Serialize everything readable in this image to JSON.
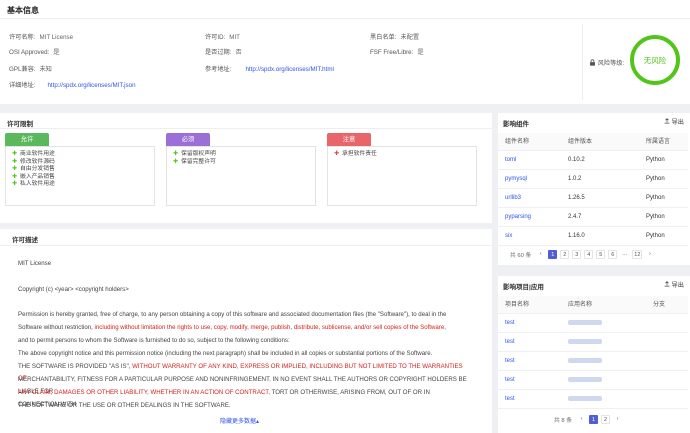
{
  "basic": {
    "title": "基本信息",
    "license_name_label": "许可名称:",
    "license_name": "MIT License",
    "license_id_label": "许可ID:",
    "license_id": "MIT",
    "blacklist_label": "黑白名单:",
    "blacklist": "未配置",
    "osi_label": "OSI Approved:",
    "osi": "是",
    "deprecated_label": "是否过期:",
    "deprecated": "否",
    "fsf_label": "FSF Free/Libre:",
    "fsf": "是",
    "gpl_label": "GPL兼容:",
    "gpl": "未知",
    "ref_label": "参考地址:",
    "ref_url": "http://spdx.org/licenses/MIT.html",
    "detail_label": "详细地址:",
    "detail_url": "http://spdx.org/licenses/MIT.json",
    "risk_label": "风险等级:",
    "risk_value": "无风险",
    "risk_color": "#52c41a"
  },
  "restrictions": {
    "title": "许可限制",
    "allowed": {
      "label": "允许",
      "color": "#5cb85c",
      "items": [
        "商业软件用途",
        "修改软件源码",
        "自由分发销售",
        "嵌入产品销售",
        "私人软件用途"
      ]
    },
    "required": {
      "label": "必须",
      "color": "#9b6fd6",
      "items": [
        "保留版权声明",
        "保留完整许可"
      ]
    },
    "note": {
      "label": "注意",
      "color": "#e8666a",
      "items": [
        "承担软件责任"
      ]
    }
  },
  "description": {
    "title": "许可描述",
    "p1": "MIT License",
    "p2": "Copyright (c) <year> <copyright holders>",
    "p3a": "Permission is hereby granted, free of charge, to any person obtaining a copy of this software and associated documentation files (the \"Software\"), to deal in the",
    "p3b_plain": "Software without restriction, ",
    "p3b_red": "including without limitation the rights to use, copy, modify, merge, publish, distribute, sublicense, and/or sell copies of the Software,",
    "p3c": "and to permit persons to whom the Software is furnished to do so, subject to the following conditions:",
    "p4": "The above copyright notice and this permission notice (including the next paragraph) shall be included in all copies or substantial portions of the Software.",
    "p5a_plain": "THE SOFTWARE IS PROVIDED \"AS IS\", ",
    "p5a_red": "WITHOUT WARRANTY OF ANY KIND, EXPRESS OR IMPLIED, INCLUDING BUT NOT LIMITED TO THE WARRANTIES OF",
    "p5b_red": "MERCHANTABILITY, FITNESS FOR A PARTICULAR PURPOSE AND NONINFRINGEMENT. IN NO EVENT SHALL THE AUTHORS OR COPYRIGHT HOLDERS BE LIABLE FOR",
    "p5c_red": "ANY CLAIM, DAMAGES OR OTHER LIABILITY, WHETHER IN AN ACTION OF CONTRACT,",
    "p5c_plain": " TORT OR OTHERWISE, ARISING FROM, OUT OF OR IN CONNECTION WITH",
    "p5d": "THE SOFTWARE OR THE USE OR OTHER DEALINGS IN THE SOFTWARE.",
    "collapse": "隐藏更多数据▴"
  },
  "components": {
    "title": "影响组件",
    "export": "导出",
    "headers": [
      "组件名称",
      "组件版本",
      "所属语言"
    ],
    "rows": [
      [
        "toml",
        "0.10.2",
        "Python"
      ],
      [
        "pymysql",
        "1.0.2",
        "Python"
      ],
      [
        "urllib3",
        "1.26.5",
        "Python"
      ],
      [
        "pyparsing",
        "2.4.7",
        "Python"
      ],
      [
        "six",
        "1.16.0",
        "Python"
      ]
    ],
    "total": "共 60 条",
    "pages": [
      "1",
      "2",
      "3",
      "4",
      "5",
      "6",
      "…",
      "12"
    ],
    "prev": "‹",
    "next": "›"
  },
  "projects": {
    "title": "影响项目|应用",
    "export": "导出",
    "headers": [
      "项目名称",
      "应用名称",
      "分支"
    ],
    "rows": [
      "test",
      "test",
      "test",
      "test",
      "test"
    ],
    "total": "共 8 条",
    "pages": [
      "1",
      "2"
    ],
    "prev": "‹",
    "next": "›"
  }
}
